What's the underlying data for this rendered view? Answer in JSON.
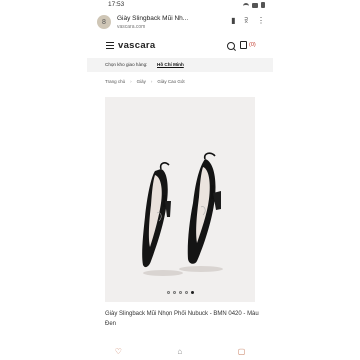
{
  "status_bar": {
    "time": "17:53"
  },
  "browser": {
    "page_title": "Giày Slingback Mũi Nh...",
    "url": "vascara.com",
    "site_icon": "8",
    "bookmark_icon": "bookmark-icon",
    "share_icon": "share-icon",
    "menu_icon": "more-vert-icon"
  },
  "header": {
    "logo": "vascara",
    "cart_count": "(0)"
  },
  "store": {
    "label": "Chọn kho giao hàng:",
    "value": "Hồ Chí Minh"
  },
  "breadcrumb": [
    "Trang chủ",
    "Giày",
    "Giày Cao Gót"
  ],
  "product": {
    "name": "Giày Slingback Mũi Nhọn Phối Nubuck - BMN 0420 - Màu Đen",
    "image_dots": 5,
    "active_dot": 4
  },
  "bottom_nav": [
    "heart-icon",
    "home-icon",
    "tag-icon"
  ]
}
